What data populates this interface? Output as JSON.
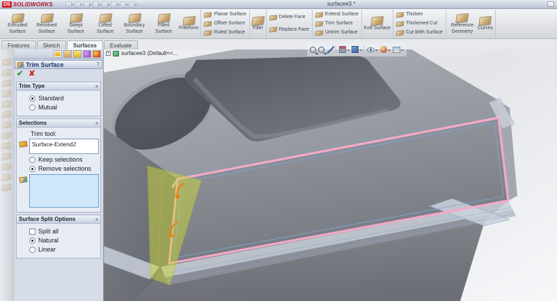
{
  "window": {
    "logo_ds": "DS",
    "logo_name": "SOLIDWORKS",
    "document_title": "surfacee3 *"
  },
  "quick_access": [
    "new",
    "open",
    "save",
    "print",
    "undo",
    "redo",
    "rebuild",
    "options"
  ],
  "ribbon": {
    "groups": [
      {
        "style": "big",
        "items": [
          {
            "name": "extruded-surface-button",
            "label": "Extruded Surface"
          },
          {
            "name": "revolved-surface-button",
            "label": "Revolved Surface"
          },
          {
            "name": "swept-surface-button",
            "label": "Swept Surface"
          },
          {
            "name": "lofted-surface-button",
            "label": "Lofted Surface"
          },
          {
            "name": "boundary-surface-button",
            "label": "Boundary Surface"
          },
          {
            "name": "filled-surface-button",
            "label": "Filled Surface"
          },
          {
            "name": "freeform-button",
            "label": "Freeform"
          }
        ]
      },
      {
        "style": "stack",
        "items": [
          {
            "name": "planar-surface-button",
            "label": "Planar Surface"
          },
          {
            "name": "offset-surface-button",
            "label": "Offset Surface"
          },
          {
            "name": "ruled-surface-button",
            "label": "Ruled Surface"
          }
        ]
      },
      {
        "style": "big",
        "items": [
          {
            "name": "fillet-button",
            "label": "Fillet"
          }
        ]
      },
      {
        "style": "stack",
        "items": [
          {
            "name": "delete-face-button",
            "label": "Delete Face"
          },
          {
            "name": "replace-face-button",
            "label": "Replace Face"
          }
        ]
      },
      {
        "style": "stack",
        "items": [
          {
            "name": "extend-surface-button",
            "label": "Extend Surface"
          },
          {
            "name": "trim-surface-button",
            "label": "Trim Surface"
          },
          {
            "name": "untrim-surface-button",
            "label": "Untrim Surface"
          }
        ]
      },
      {
        "style": "big",
        "items": [
          {
            "name": "knit-surface-button",
            "label": "Knit Surface"
          }
        ]
      },
      {
        "style": "stack",
        "items": [
          {
            "name": "thicken-button",
            "label": "Thicken"
          },
          {
            "name": "thickened-cut-button",
            "label": "Thickened Cut"
          },
          {
            "name": "cut-with-surface-button",
            "label": "Cut With Surface"
          }
        ]
      },
      {
        "style": "big",
        "items": [
          {
            "name": "reference-geometry-button",
            "label": "Reference Geometry"
          },
          {
            "name": "curves-button",
            "label": "Curves"
          }
        ]
      }
    ]
  },
  "tabs": [
    {
      "name": "tab-features",
      "label": "Features",
      "active": false
    },
    {
      "name": "tab-sketch",
      "label": "Sketch",
      "active": false
    },
    {
      "name": "tab-surfaces",
      "label": "Surfaces",
      "active": true
    },
    {
      "name": "tab-evaluate",
      "label": "Evaluate",
      "active": false
    }
  ],
  "property_manager": {
    "title": "Trim Surface",
    "help_glyph": "?",
    "ok_glyph": "✔",
    "cancel_glyph": "✘",
    "collapse_glyph": "«",
    "trim_type": {
      "title": "Trim Type",
      "options": [
        {
          "label": "Standard",
          "selected": true
        },
        {
          "label": "Mutual",
          "selected": false
        }
      ]
    },
    "selections": {
      "title": "Selections",
      "trim_tool_label": "Trim tool:",
      "trim_tool_value": "Surface-Extend2",
      "options": [
        {
          "label": "Keep selections",
          "selected": false
        },
        {
          "label": "Remove selections",
          "selected": true
        }
      ]
    },
    "surface_split": {
      "title": "Surface Split Options",
      "checkbox": {
        "label": "Split all",
        "checked": false
      },
      "options": [
        {
          "label": "Natural",
          "selected": true
        },
        {
          "label": "Linear",
          "selected": false
        }
      ]
    }
  },
  "left_toolbar_icons": [
    "extruded-surface",
    "revolved-surface",
    "swept-surface",
    "lofted-surface",
    "boundary-surface",
    "filled-surface",
    "freeform",
    "planar-surface",
    "offset-surface",
    "ruled-surface",
    "fillet",
    "delete-face",
    "replace-face"
  ],
  "pm_tab_icons": [
    {
      "name": "propertymanager-tab-icon",
      "type": "pm",
      "active": true
    },
    {
      "name": "configuration-manager-tab-icon",
      "type": "config",
      "active": false
    },
    {
      "name": "dimxpert-tab-icon",
      "type": "dim",
      "active": false
    },
    {
      "name": "display-manager-tab-icon",
      "type": "disp",
      "active": false
    },
    {
      "name": "office-products-tab-icon",
      "type": "office",
      "active": false
    }
  ],
  "headsup": [
    {
      "name": "zoom-to-fit-icon",
      "type": "magnifier",
      "dropdown": false,
      "sep": false
    },
    {
      "name": "zoom-to-area-icon",
      "type": "magnifier",
      "dropdown": false,
      "sep": false
    },
    {
      "name": "view-settings-icon",
      "type": "wand",
      "dropdown": false,
      "sep": true
    },
    {
      "name": "view-orientation-icon",
      "type": "cube-red",
      "dropdown": true,
      "sep": false
    },
    {
      "name": "display-style-icon",
      "type": "cube-blue",
      "dropdown": true,
      "sep": true
    },
    {
      "name": "hide-show-items-icon",
      "type": "eye",
      "dropdown": true,
      "sep": false
    },
    {
      "name": "edit-appearance-icon",
      "type": "sphere",
      "dropdown": true,
      "sep": false
    },
    {
      "name": "apply-scene-icon",
      "type": "scene",
      "dropdown": true,
      "sep": false
    }
  ],
  "graphics": {
    "feature_tree_root": "surfacee3  (Default<<...",
    "tree_expand_glyph": "+"
  },
  "colors": {
    "highlight_pink": "#f3aac9",
    "trim_tool_yellow": "#ccd83c",
    "edge_blue": "#7fa7d9",
    "selection_box_blue": "#cfe7fa",
    "ok_green": "#2a9b2a",
    "cancel_red": "#d22020",
    "arrow_orange": "#e8821e"
  }
}
